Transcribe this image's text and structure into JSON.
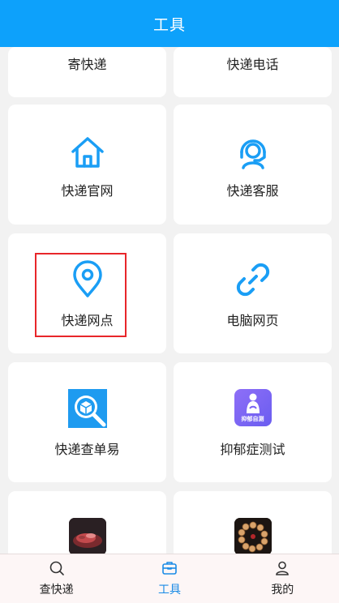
{
  "header": {
    "title": "工具"
  },
  "grid": {
    "items": [
      {
        "label": "寄快递",
        "icon": "partial-hidden"
      },
      {
        "label": "快递电话",
        "icon": "partial-hidden"
      },
      {
        "label": "快递官网",
        "icon": "home-icon"
      },
      {
        "label": "快递客服",
        "icon": "customer-service-icon"
      },
      {
        "label": "快递网点",
        "icon": "location-pin-icon"
      },
      {
        "label": "电脑网页",
        "icon": "link-icon"
      },
      {
        "label": "快递查单易",
        "icon": "package-search-icon"
      },
      {
        "label": "抑郁症测试",
        "icon": "depression-test-app-icon",
        "icon_text": "抑郁自测"
      },
      {
        "label": "",
        "icon": "food-app-icon"
      },
      {
        "label": "",
        "icon": "beads-app-icon"
      }
    ]
  },
  "tabbar": {
    "items": [
      {
        "label": "查快递",
        "icon": "search-icon",
        "active": false
      },
      {
        "label": "工具",
        "icon": "toolbox-icon",
        "active": true
      },
      {
        "label": "我的",
        "icon": "user-icon",
        "active": false
      }
    ]
  },
  "colors": {
    "header": "#0da1fb",
    "accent": "#1a8be6",
    "highlight": "#e8262a",
    "background": "#f2f2f2"
  }
}
